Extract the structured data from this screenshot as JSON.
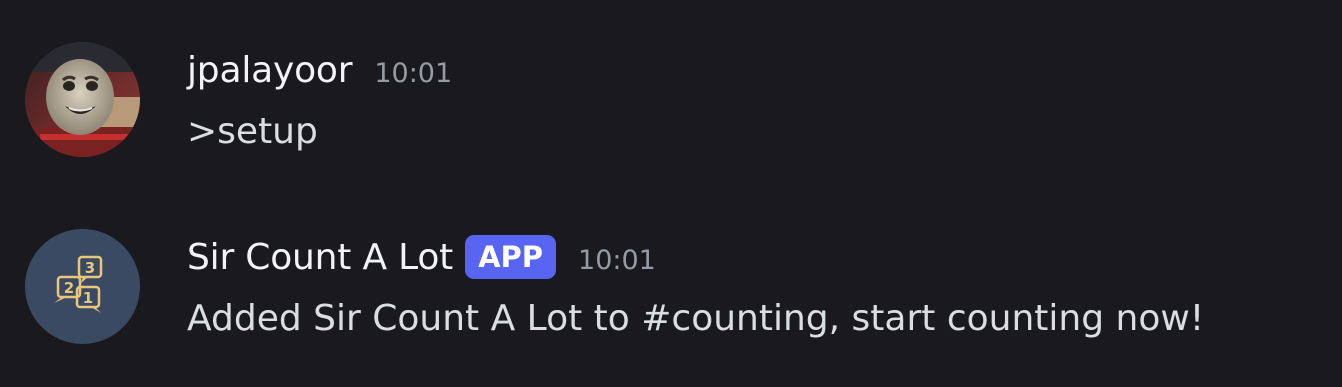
{
  "messages": [
    {
      "author": "jpalayoor",
      "timestamp": "10:01",
      "content": ">setup",
      "avatar_icon": "user-avatar-cartoon-face"
    },
    {
      "author": "Sir Count A Lot",
      "badge": "APP",
      "timestamp": "10:01",
      "content": "Added Sir Count A Lot to #counting, start counting now!",
      "avatar_icon": "counting-speech-bubbles-icon",
      "avatar_numbers": [
        "3",
        "2",
        "1"
      ]
    }
  ],
  "colors": {
    "background": "#1a1a1e",
    "username": "#f2f3f5",
    "message_text": "#dbdee1",
    "timestamp": "#949ba4",
    "app_badge": "#5865f2",
    "bot_avatar_bg": "#3b4a63",
    "bot_icon": "#e8c67a"
  }
}
